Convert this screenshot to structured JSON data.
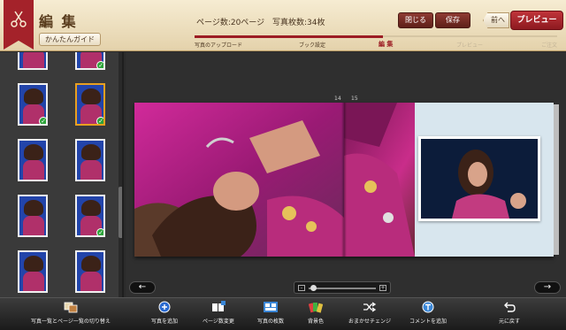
{
  "header": {
    "title": "編 集",
    "guide_button": "かんたんガイド",
    "page_count": "ページ数:20ページ",
    "photo_count": "写真枚数:34枚",
    "close_button": "閉じる",
    "save_button": "保存",
    "prev_button": "前へ",
    "preview_button": "プレビュー",
    "steps": [
      "写真のアップロード",
      "ブック設定",
      "編 集",
      "プレビュー",
      "ご注文"
    ],
    "active_step": 2,
    "progress_percent": 52,
    "accent_color": "#9c1c24"
  },
  "sidebar": {
    "thumbnails": [
      {
        "checked": false,
        "selected": false
      },
      {
        "checked": true,
        "selected": false
      },
      {
        "checked": true,
        "selected": false
      },
      {
        "checked": true,
        "selected": true
      },
      {
        "checked": false,
        "selected": false
      },
      {
        "checked": false,
        "selected": false
      },
      {
        "checked": false,
        "selected": false
      },
      {
        "checked": true,
        "selected": false
      },
      {
        "checked": false,
        "selected": false
      },
      {
        "checked": false,
        "selected": false
      }
    ]
  },
  "main": {
    "page_left": "14",
    "page_right": "15"
  },
  "toolbar": {
    "items": [
      {
        "label": "写真一覧とページ一覧の切り替え",
        "icon": "switch-view-icon"
      },
      {
        "label": "写真を追加",
        "icon": "add-photo-icon"
      },
      {
        "label": "ページ数変更",
        "icon": "page-count-icon"
      },
      {
        "label": "写真の枚数",
        "icon": "photo-count-icon"
      },
      {
        "label": "背景色",
        "icon": "background-color-icon"
      },
      {
        "label": "おまかせチェンジ",
        "icon": "shuffle-icon"
      },
      {
        "label": "コメントを追加",
        "icon": "add-comment-icon"
      },
      {
        "label": "元に戻す",
        "icon": "undo-icon"
      }
    ]
  }
}
